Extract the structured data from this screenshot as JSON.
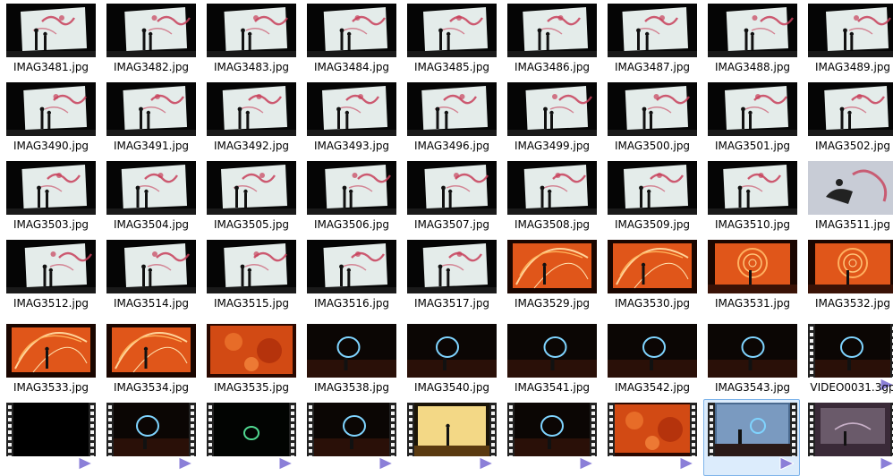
{
  "files": [
    {
      "name": "IMAG3481.jpg",
      "kind": "image",
      "scene": "white-red"
    },
    {
      "name": "IMAG3482.jpg",
      "kind": "image",
      "scene": "white-red"
    },
    {
      "name": "IMAG3483.jpg",
      "kind": "image",
      "scene": "white-red"
    },
    {
      "name": "IMAG3484.jpg",
      "kind": "image",
      "scene": "white-red"
    },
    {
      "name": "IMAG3485.jpg",
      "kind": "image",
      "scene": "white-red"
    },
    {
      "name": "IMAG3486.jpg",
      "kind": "image",
      "scene": "white-red"
    },
    {
      "name": "IMAG3487.jpg",
      "kind": "image",
      "scene": "white-red"
    },
    {
      "name": "IMAG3488.jpg",
      "kind": "image",
      "scene": "white-red"
    },
    {
      "name": "IMAG3489.jpg",
      "kind": "image",
      "scene": "white-red"
    },
    {
      "name": "IMAG3490.jpg",
      "kind": "image",
      "scene": "white-red"
    },
    {
      "name": "IMAG3491.jpg",
      "kind": "image",
      "scene": "white-red"
    },
    {
      "name": "IMAG3492.jpg",
      "kind": "image",
      "scene": "white-red"
    },
    {
      "name": "IMAG3493.jpg",
      "kind": "image",
      "scene": "white-red"
    },
    {
      "name": "IMAG3496.jpg",
      "kind": "image",
      "scene": "white-red"
    },
    {
      "name": "IMAG3499.jpg",
      "kind": "image",
      "scene": "white-red"
    },
    {
      "name": "IMAG3500.jpg",
      "kind": "image",
      "scene": "white-red"
    },
    {
      "name": "IMAG3501.jpg",
      "kind": "image",
      "scene": "white-red"
    },
    {
      "name": "IMAG3502.jpg",
      "kind": "image",
      "scene": "white-red"
    },
    {
      "name": "IMAG3503.jpg",
      "kind": "image",
      "scene": "white-red"
    },
    {
      "name": "IMAG3504.jpg",
      "kind": "image",
      "scene": "white-red"
    },
    {
      "name": "IMAG3505.jpg",
      "kind": "image",
      "scene": "white-red"
    },
    {
      "name": "IMAG3506.jpg",
      "kind": "image",
      "scene": "white-red"
    },
    {
      "name": "IMAG3507.jpg",
      "kind": "image",
      "scene": "white-red"
    },
    {
      "name": "IMAG3508.jpg",
      "kind": "image",
      "scene": "white-red"
    },
    {
      "name": "IMAG3509.jpg",
      "kind": "image",
      "scene": "white-red"
    },
    {
      "name": "IMAG3510.jpg",
      "kind": "image",
      "scene": "white-red"
    },
    {
      "name": "IMAG3511.jpg",
      "kind": "image",
      "scene": "closeup-red"
    },
    {
      "name": "IMAG3512.jpg",
      "kind": "image",
      "scene": "white-red"
    },
    {
      "name": "IMAG3514.jpg",
      "kind": "image",
      "scene": "white-red"
    },
    {
      "name": "IMAG3515.jpg",
      "kind": "image",
      "scene": "white-red"
    },
    {
      "name": "IMAG3516.jpg",
      "kind": "image",
      "scene": "white-red"
    },
    {
      "name": "IMAG3517.jpg",
      "kind": "image",
      "scene": "white-red"
    },
    {
      "name": "IMAG3529.jpg",
      "kind": "image",
      "scene": "orange-swirl"
    },
    {
      "name": "IMAG3530.jpg",
      "kind": "image",
      "scene": "orange-swirl"
    },
    {
      "name": "IMAG3531.jpg",
      "kind": "image",
      "scene": "orange-spiral"
    },
    {
      "name": "IMAG3532.jpg",
      "kind": "image",
      "scene": "orange-spiral"
    },
    {
      "name": "IMAG3533.jpg",
      "kind": "image",
      "scene": "orange-swirl"
    },
    {
      "name": "IMAG3534.jpg",
      "kind": "image",
      "scene": "orange-swirl"
    },
    {
      "name": "IMAG3535.jpg",
      "kind": "image",
      "scene": "orange-texture"
    },
    {
      "name": "IMAG3538.jpg",
      "kind": "image",
      "scene": "dark-blue-ring"
    },
    {
      "name": "IMAG3540.jpg",
      "kind": "image",
      "scene": "dark-blue-ring"
    },
    {
      "name": "IMAG3541.jpg",
      "kind": "image",
      "scene": "dark-blue-ring"
    },
    {
      "name": "IMAG3542.jpg",
      "kind": "image",
      "scene": "dark-blue-ring"
    },
    {
      "name": "IMAG3543.jpg",
      "kind": "image",
      "scene": "dark-blue-ring"
    },
    {
      "name": "VIDEO0031.3gp",
      "kind": "video",
      "scene": "dark-blue-ring"
    },
    {
      "name": "",
      "kind": "video",
      "scene": "black"
    },
    {
      "name": "",
      "kind": "video",
      "scene": "dark-blue-ring"
    },
    {
      "name": "",
      "kind": "video",
      "scene": "dark-green-ring"
    },
    {
      "name": "",
      "kind": "video",
      "scene": "dark-blue-ring"
    },
    {
      "name": "",
      "kind": "video",
      "scene": "yellow-stage"
    },
    {
      "name": "",
      "kind": "video",
      "scene": "dark-blue-ring"
    },
    {
      "name": "",
      "kind": "video",
      "scene": "orange-texture"
    },
    {
      "name": "",
      "kind": "video",
      "scene": "blue-stage",
      "selected": true
    },
    {
      "name": "",
      "kind": "video",
      "scene": "dark-purple"
    }
  ],
  "colors": {
    "selection_bg": "#dcecfc",
    "selection_border": "#7eb4ea",
    "screen_white": "#e4ecea",
    "paint_red": "#c8405a",
    "orange": "#e0561a",
    "blue_glow": "#7fd4ff",
    "video_badge": "#8b7fd8"
  }
}
